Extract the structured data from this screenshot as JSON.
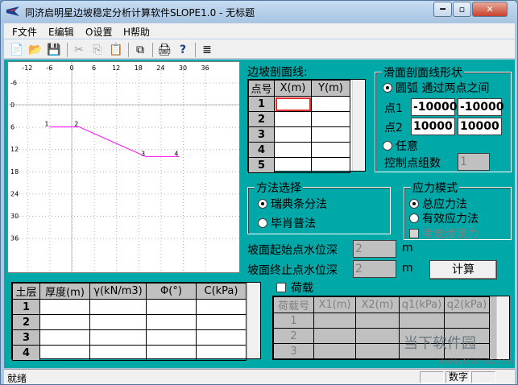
{
  "window": {
    "title": "同济启明星边坡稳定分析计算软件SLOPE1.0 - 无标题",
    "controls": [
      "━",
      "▫",
      "✕"
    ]
  },
  "menu": [
    "F文件",
    "E编辑",
    "O设置",
    "H帮助"
  ],
  "toolbar_icons": [
    "📄",
    "📂",
    "💾",
    "✂",
    "⎘",
    "📋",
    "⧉",
    "🖨",
    "?",
    "≣"
  ],
  "plot": {
    "x_ticks": [
      "-12",
      "-6",
      "0",
      "6",
      "12",
      "18",
      "24",
      "30",
      "36"
    ],
    "y_ticks": [
      "-6",
      "0",
      "6",
      "12",
      "18",
      "24",
      "30",
      "36"
    ],
    "point_labels": [
      "1",
      "2",
      "3",
      "4"
    ],
    "line_color": "#ff00ff",
    "profile_points": [
      [
        -6,
        6
      ],
      [
        2,
        6
      ],
      [
        20,
        14
      ],
      [
        29,
        14
      ]
    ]
  },
  "slope_profile": {
    "label": "边坡剖面线:",
    "headers": [
      "点号",
      "X(m)",
      "Y(m)"
    ],
    "rows": [
      "1",
      "2",
      "3",
      "4",
      "5"
    ]
  },
  "slip_shape": {
    "title": "滑面剖面线形状",
    "arc_label": "圆弧  通过两点之间",
    "p1_label": "点1",
    "p2_label": "点2",
    "p1_x": "-10000",
    "p1_y": "-10000",
    "p2_x": "10000",
    "p2_y": "10000",
    "arbitrary_label": "任意",
    "ctrl_label": "控制点组数",
    "ctrl_value": "1"
  },
  "method": {
    "title": "方法选择",
    "opt1": "瑞典条分法",
    "opt2": "毕肖普法"
  },
  "stress": {
    "title": "应力模式",
    "opt1": "总应力法",
    "opt2": "有效应力法",
    "seepage": "考虑渗流力"
  },
  "water": {
    "start_label": "坡面起始点水位深",
    "end_label": "坡面终止点水位深",
    "start_value": "2",
    "end_value": "2",
    "unit": "m"
  },
  "calc_label": "计算",
  "load": {
    "label": "荷载",
    "headers": [
      "荷载号",
      "X1(m)",
      "X2(m)",
      "q1(kPa)",
      "q2(kPa)"
    ],
    "rows": [
      "1",
      "2",
      "3"
    ]
  },
  "soil": {
    "headers": [
      "土层",
      "厚度(m)",
      "γ(kN/m3)",
      "Φ(°)",
      "C(kPa)"
    ],
    "rows": [
      "1",
      "2",
      "3",
      "4"
    ]
  },
  "status": {
    "ready": "就绪",
    "numlock": "数字"
  },
  "watermark": {
    "name": "当下软件园",
    "url": "www.downxia.com"
  }
}
